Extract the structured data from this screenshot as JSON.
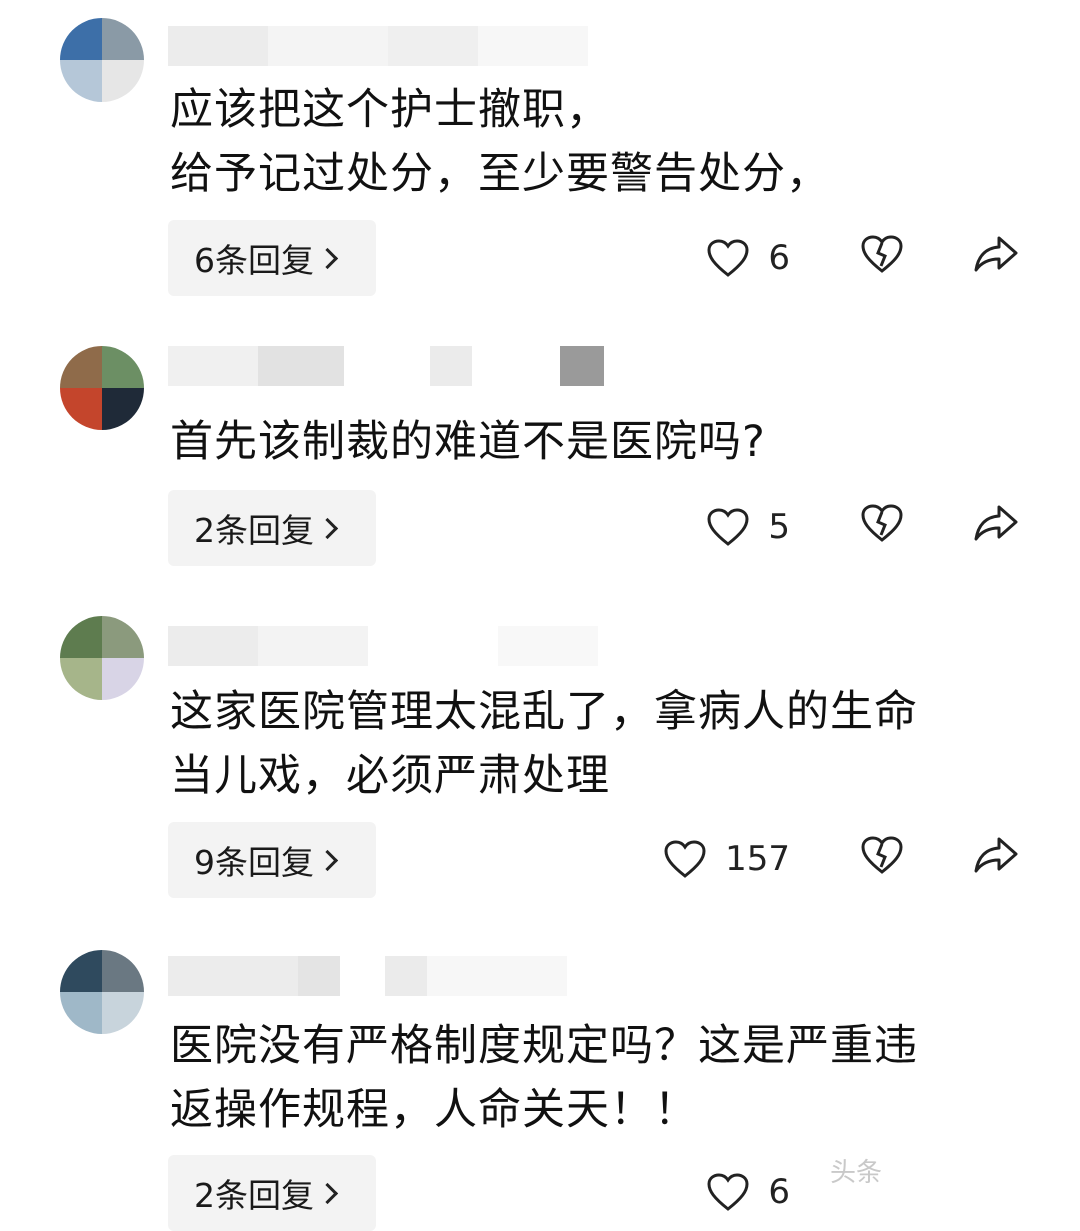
{
  "comments": [
    {
      "text": "应该把这个护士撤职，\n给予记过处分，至少要警告处分，",
      "replies_label": "6条回复",
      "likes": "6",
      "avatar_colors": [
        "#3d6fa8",
        "#8a9aa6",
        "#b5c7d8",
        "#e6e6e6"
      ]
    },
    {
      "text": "首先该制裁的难道不是医院吗?",
      "replies_label": "2条回复",
      "likes": "5",
      "avatar_colors": [
        "#8f6b4a",
        "#6c8f64",
        "#c4452c",
        "#1f2a38"
      ]
    },
    {
      "text": "这家医院管理太混乱了，拿病人的生命\n当儿戏，必须严肃处理",
      "replies_label": "9条回复",
      "likes": "157",
      "avatar_colors": [
        "#5e7c4f",
        "#8b9a7d",
        "#a6b58a",
        "#d8d4e6"
      ]
    },
    {
      "text": "医院没有严格制度规定吗？这是严重违\n返操作规程，人命关天！！",
      "replies_label": "2条回复",
      "likes": "6",
      "avatar_colors": [
        "#2f4a5e",
        "#6a7882",
        "#9fb8c8",
        "#c8d4dc"
      ]
    }
  ],
  "watermark": "头条"
}
